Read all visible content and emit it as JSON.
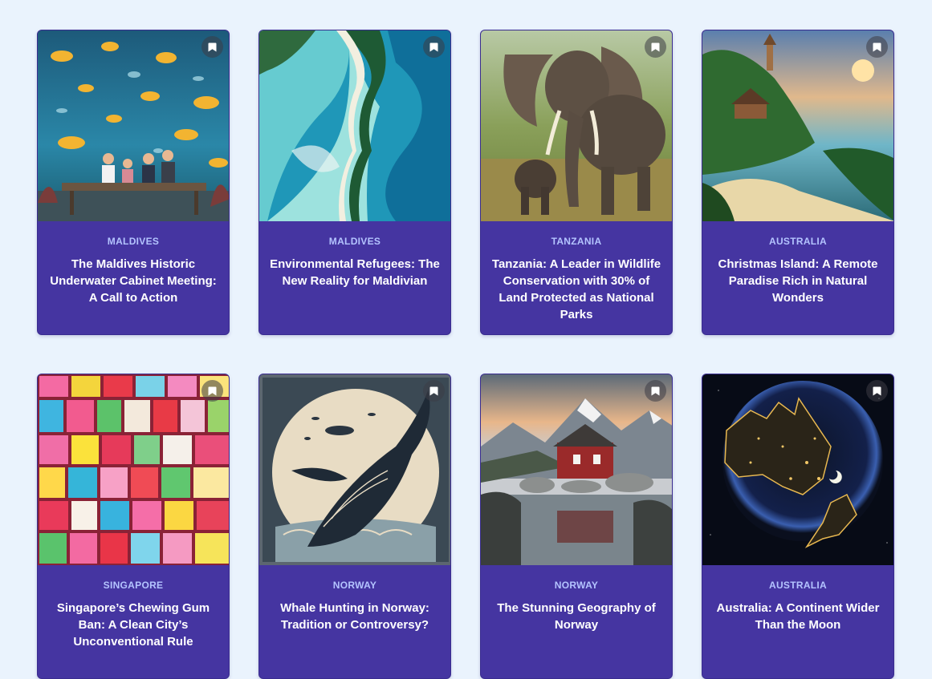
{
  "cards": [
    {
      "country": "MALDIVES",
      "title": "The Maldives Historic Underwater Cabinet Meeting: A Call to Action",
      "image_icon": "underwater-meeting-image"
    },
    {
      "country": "MALDIVES",
      "title": "Environmental Refugees: The New Reality for Maldivian",
      "image_icon": "island-aerial-image"
    },
    {
      "country": "TANZANIA",
      "title": "Tanzania: A Leader in Wildlife Conservation with 30% of Land Protected as National Parks",
      "image_icon": "elephant-image"
    },
    {
      "country": "AUSTRALIA",
      "title": "Christmas Island: A Remote Paradise Rich in Natural Wonders",
      "image_icon": "tropical-island-image"
    },
    {
      "country": "SINGAPORE",
      "title": "Singapore’s Chewing Gum Ban: A Clean City’s Unconventional Rule",
      "image_icon": "candy-packs-image"
    },
    {
      "country": "NORWAY",
      "title": "Whale Hunting in Norway: Tradition or Controversy?",
      "image_icon": "whale-illustration-image"
    },
    {
      "country": "NORWAY",
      "title": "The Stunning Geography of Norway",
      "image_icon": "fjord-house-image"
    },
    {
      "country": "AUSTRALIA",
      "title": "Australia: A Continent Wider Than the Moon",
      "image_icon": "australia-moon-image"
    }
  ],
  "colors": {
    "background": "#eaf3fd",
    "card": "#4535a1",
    "country": "#b4c4ff",
    "title": "#ffffff"
  },
  "bookmark_icon": "bookmark-icon"
}
